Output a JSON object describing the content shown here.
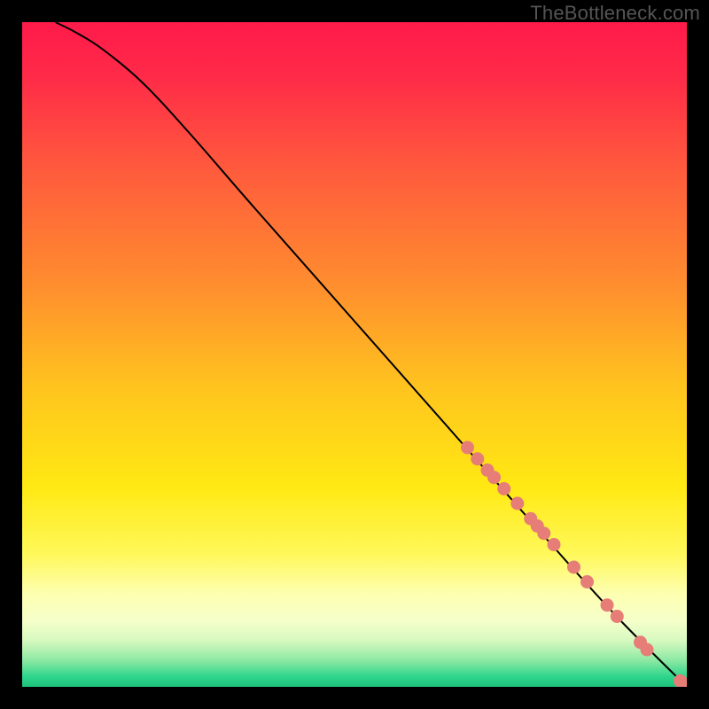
{
  "watermark": "TheBottleneck.com",
  "colors": {
    "gradient_stops": [
      {
        "offset": 0,
        "color": "#ff1a4a"
      },
      {
        "offset": 0.08,
        "color": "#ff2a48"
      },
      {
        "offset": 0.22,
        "color": "#ff5a3d"
      },
      {
        "offset": 0.4,
        "color": "#ff8f2e"
      },
      {
        "offset": 0.55,
        "color": "#ffc41e"
      },
      {
        "offset": 0.7,
        "color": "#ffe913"
      },
      {
        "offset": 0.8,
        "color": "#fff85a"
      },
      {
        "offset": 0.86,
        "color": "#fdffb0"
      },
      {
        "offset": 0.9,
        "color": "#f6ffca"
      },
      {
        "offset": 0.93,
        "color": "#d7f9c0"
      },
      {
        "offset": 0.96,
        "color": "#8de9a3"
      },
      {
        "offset": 0.985,
        "color": "#2dd58c"
      },
      {
        "offset": 1.0,
        "color": "#1fc27b"
      }
    ],
    "curve": "#000000",
    "dot_fill": "#e67d77",
    "dot_stroke": "#c25a55"
  },
  "chart_data": {
    "type": "line",
    "title": "",
    "xlabel": "",
    "ylabel": "",
    "xlim": [
      0,
      100
    ],
    "ylim": [
      0,
      100
    ],
    "grid": false,
    "legend": null,
    "annotations": [],
    "series": [
      {
        "name": "curve",
        "kind": "line",
        "x": [
          5,
          8,
          12,
          18,
          25,
          35,
          50,
          65,
          80,
          90,
          100
        ],
        "y": [
          100,
          98.5,
          96,
          91,
          83.5,
          72,
          55,
          38,
          21,
          10,
          0
        ]
      },
      {
        "name": "dots",
        "kind": "scatter",
        "x": [
          67.0,
          68.5,
          70.0,
          71.0,
          72.5,
          74.5,
          76.5,
          77.5,
          78.5,
          80.0,
          83.0,
          85.0,
          88.0,
          89.5,
          93.0,
          94.0,
          99.0,
          100.0
        ],
        "y": [
          36.0,
          34.3,
          32.6,
          31.5,
          29.8,
          27.6,
          25.3,
          24.2,
          23.1,
          21.4,
          18.0,
          15.8,
          12.3,
          10.6,
          6.7,
          5.6,
          0.9,
          0.4
        ]
      }
    ]
  }
}
